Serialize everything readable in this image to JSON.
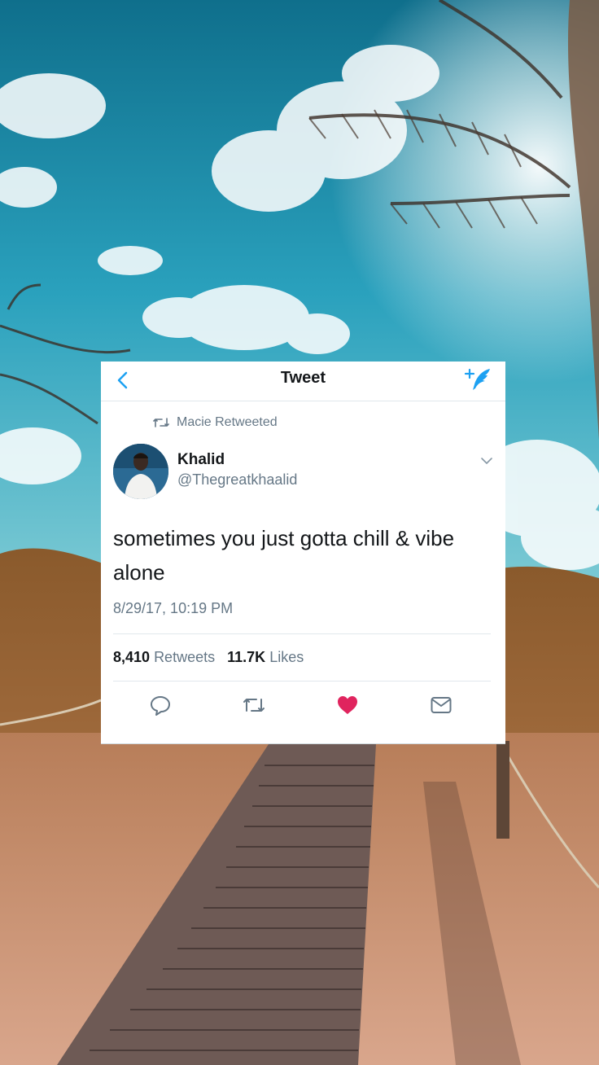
{
  "nav": {
    "title": "Tweet",
    "back_icon": "chevron-left-icon",
    "compose_icon": "compose-tweet-icon"
  },
  "retweet": {
    "icon": "retweet-icon",
    "label": "Macie Retweeted"
  },
  "author": {
    "name": "Khalid",
    "handle": "@Thegreatkhaalid"
  },
  "tweet": {
    "text": "sometimes you just gotta chill & vibe alone",
    "timestamp": "8/29/17, 10:19 PM"
  },
  "stats": {
    "retweets_count": "8,410",
    "retweets_label": "Retweets",
    "likes_count": "11.7K",
    "likes_label": "Likes"
  },
  "actions": [
    "reply-icon",
    "retweet-icon",
    "like-heart-icon",
    "direct-message-icon"
  ],
  "colors": {
    "twitter_blue": "#1da1f2",
    "like_red": "#e0245e",
    "text_primary": "#14171a",
    "text_secondary": "#657786"
  }
}
